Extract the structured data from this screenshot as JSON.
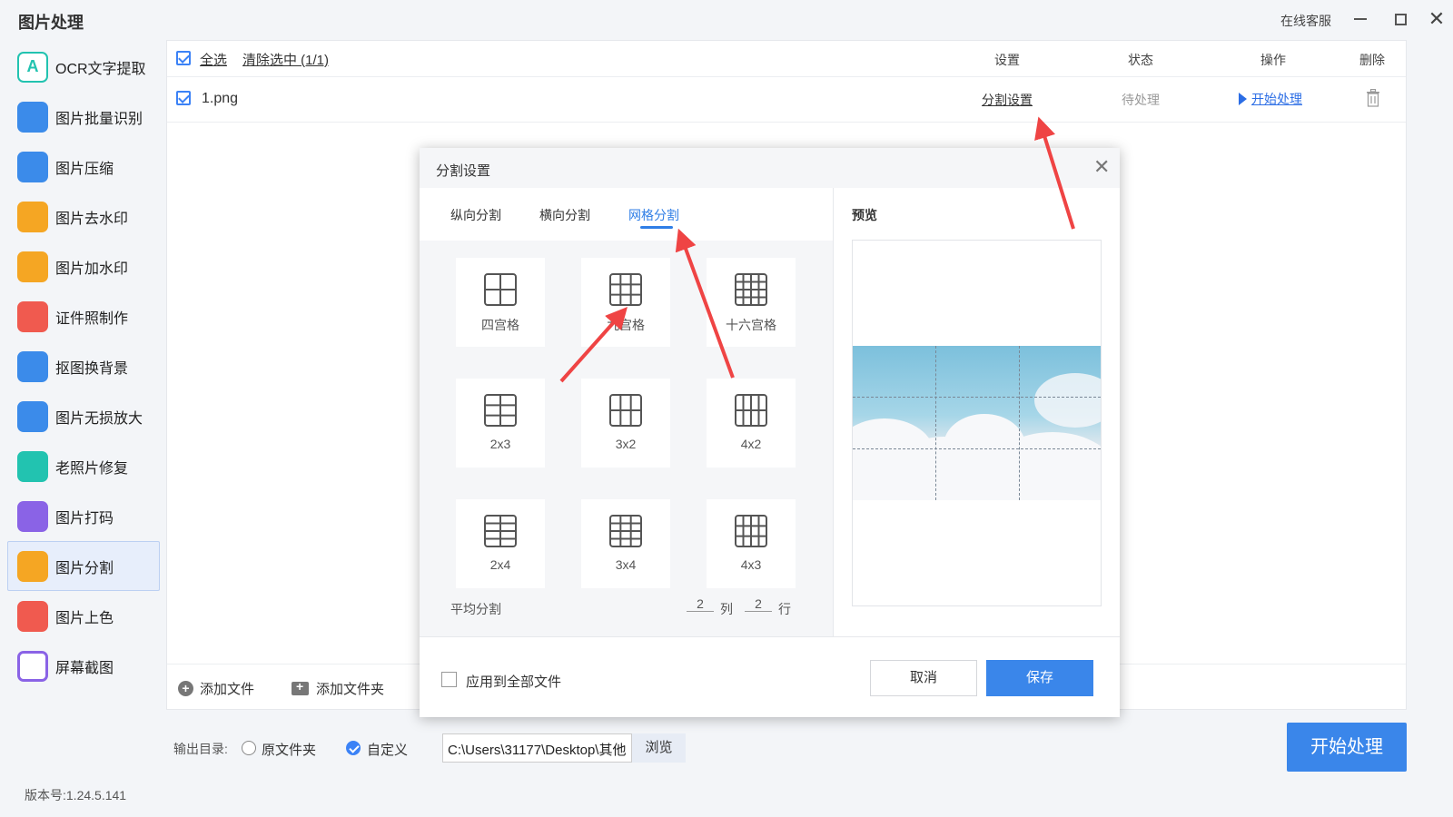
{
  "app": {
    "title": "图片处理",
    "service": "在线客服",
    "version": "版本号:1.24.5.141"
  },
  "sidebar": {
    "items": [
      {
        "label": "OCR文字提取",
        "icon": "ocr-icon",
        "color": "#ffffff"
      },
      {
        "label": "图片批量识别",
        "icon": "image-recognize-icon",
        "color": "#3b8bea"
      },
      {
        "label": "图片压缩",
        "icon": "compress-icon",
        "color": "#3b8bea"
      },
      {
        "label": "图片去水印",
        "icon": "remove-watermark-icon",
        "color": "#f5a623"
      },
      {
        "label": "图片加水印",
        "icon": "add-watermark-icon",
        "color": "#f5a623"
      },
      {
        "label": "证件照制作",
        "icon": "id-photo-icon",
        "color": "#f05a4f"
      },
      {
        "label": "抠图换背景",
        "icon": "cutout-icon",
        "color": "#3b8bea"
      },
      {
        "label": "图片无损放大",
        "icon": "enlarge-icon",
        "color": "#3b8bea"
      },
      {
        "label": "老照片修复",
        "icon": "repair-icon",
        "color": "#22c3b0"
      },
      {
        "label": "图片打码",
        "icon": "mosaic-icon",
        "color": "#8a63e6"
      },
      {
        "label": "图片分割",
        "icon": "split-icon",
        "color": "#f5a623"
      },
      {
        "label": "图片上色",
        "icon": "colorize-icon",
        "color": "#f05a4f"
      },
      {
        "label": "屏幕截图",
        "icon": "screenshot-icon",
        "color": "#8a63e6"
      }
    ],
    "active_index": 10
  },
  "table": {
    "select_all": "全选",
    "clear_selection": "清除选中 (1/1)",
    "columns": {
      "settings": "设置",
      "status": "状态",
      "operation": "操作",
      "delete": "删除"
    },
    "rows": [
      {
        "name": "1.png",
        "settings_link": "分割设置",
        "status": "待处理",
        "action": "开始处理"
      }
    ]
  },
  "footer": {
    "add_file": "添加文件",
    "add_folder": "添加文件夹"
  },
  "output": {
    "label": "输出目录:",
    "option_original": "原文件夹",
    "option_custom": "自定义",
    "path": "C:\\Users\\31177\\Desktop\\其他",
    "browse": "浏览",
    "start": "开始处理"
  },
  "dialog": {
    "title": "分割设置",
    "tabs": [
      "纵向分割",
      "横向分割",
      "网格分割"
    ],
    "active_tab": 2,
    "grids": [
      {
        "label": "四宫格",
        "cols": 2,
        "rows": 2
      },
      {
        "label": "九宫格",
        "cols": 3,
        "rows": 3
      },
      {
        "label": "十六宫格",
        "cols": 4,
        "rows": 4
      },
      {
        "label": "2x3",
        "cols": 2,
        "rows": 3
      },
      {
        "label": "3x2",
        "cols": 3,
        "rows": 2
      },
      {
        "label": "4x2",
        "cols": 4,
        "rows": 2
      },
      {
        "label": "2x4",
        "cols": 2,
        "rows": 4
      },
      {
        "label": "3x4",
        "cols": 3,
        "rows": 4
      },
      {
        "label": "4x3",
        "cols": 4,
        "rows": 3
      }
    ],
    "average_label": "平均分割",
    "cols_value": "2",
    "cols_unit": "列",
    "rows_value": "2",
    "rows_unit": "行",
    "preview_title": "预览",
    "apply_all": "应用到全部文件",
    "cancel": "取消",
    "save": "保存"
  },
  "colors": {
    "accent": "#3a86ea",
    "arrow": "#ef4444"
  }
}
